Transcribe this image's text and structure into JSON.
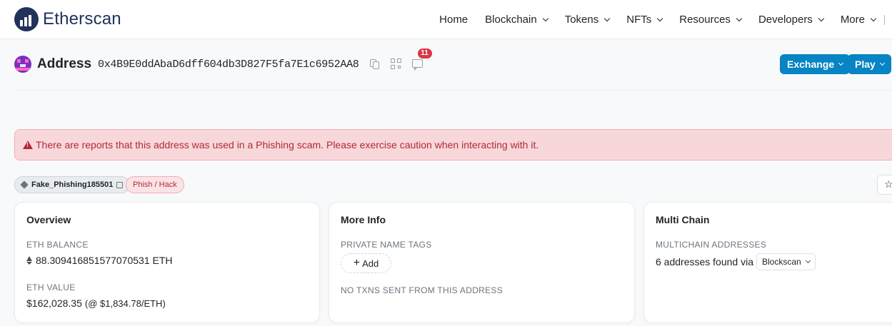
{
  "header": {
    "brand": "Etherscan",
    "nav": [
      {
        "label": "Home",
        "dropdown": false
      },
      {
        "label": "Blockchain",
        "dropdown": true
      },
      {
        "label": "Tokens",
        "dropdown": true
      },
      {
        "label": "NFTs",
        "dropdown": true
      },
      {
        "label": "Resources",
        "dropdown": true
      },
      {
        "label": "Developers",
        "dropdown": true
      },
      {
        "label": "More",
        "dropdown": true
      }
    ]
  },
  "address": {
    "label": "Address",
    "hash": "0x4B9E0ddAbaD6dff604db3D827F5fa7E1c6952AA8",
    "comment_count": "11"
  },
  "actions": {
    "exchange": "Exchange",
    "play": "Play"
  },
  "alert": {
    "text": "There are reports that this address was used in a Phishing scam. Please exercise caution when interacting with it."
  },
  "tags": {
    "name_tag": "Fake_Phishing185501",
    "category": "Phish / Hack"
  },
  "overview": {
    "title": "Overview",
    "eth_balance_label": "ETH BALANCE",
    "eth_balance": "88.309416851577070531 ETH",
    "eth_value_label": "ETH VALUE",
    "eth_value": "$162,028.35",
    "eth_price": "(@ $1,834.78/ETH)"
  },
  "more_info": {
    "title": "More Info",
    "private_tags_label": "PRIVATE NAME TAGS",
    "add_label": "Add",
    "no_txns": "NO TXNS SENT FROM THIS ADDRESS"
  },
  "multi_chain": {
    "title": "Multi Chain",
    "label": "MULTICHAIN ADDRESSES",
    "text": "6 addresses found via",
    "source": "Blockscan"
  },
  "colors": {
    "brand": "#21325b",
    "accent": "#0784c3",
    "danger": "#b02a37",
    "alert_bg": "#f8d7da"
  }
}
